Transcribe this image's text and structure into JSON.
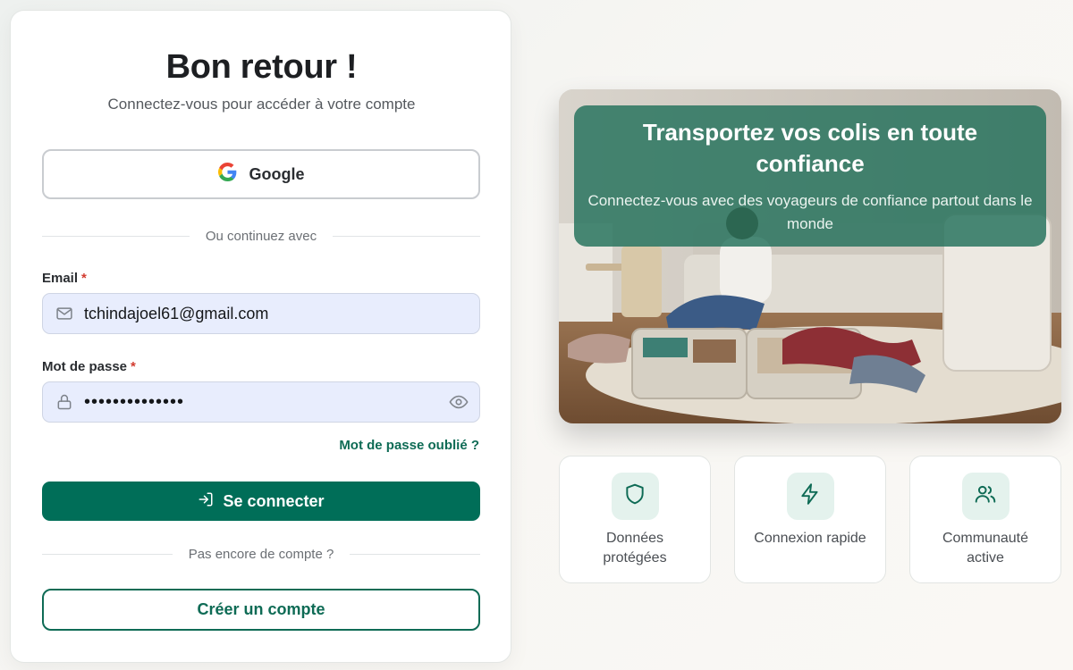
{
  "login": {
    "title": "Bon retour !",
    "subtitle": "Connectez-vous pour accéder à votre compte",
    "google_label": "Google",
    "divider_text": "Ou continuez avec",
    "email_label": "Email",
    "email_required": "*",
    "email_value": "tchindajoel61@gmail.com",
    "password_label": "Mot de passe",
    "password_required": "*",
    "password_value": "••••••••••••••",
    "forgot_label": "Mot de passe oublié ?",
    "login_label": "Se connecter",
    "no_account_text": "Pas encore de compte ?",
    "create_account_label": "Créer un compte"
  },
  "hero": {
    "title": "Transportez vos colis en toute confiance",
    "subtitle": "Connectez-vous avec des voyageurs de confiance partout dans le monde"
  },
  "features": [
    {
      "icon": "shield-icon",
      "label": "Données protégées"
    },
    {
      "icon": "zap-icon",
      "label": "Connexion rapide"
    },
    {
      "icon": "users-icon",
      "label": "Communauté active"
    }
  ],
  "colors": {
    "primary": "#006e58",
    "accent_text": "#0e6b55",
    "field_bg": "#e8edfd",
    "required": "#d23b2f"
  }
}
